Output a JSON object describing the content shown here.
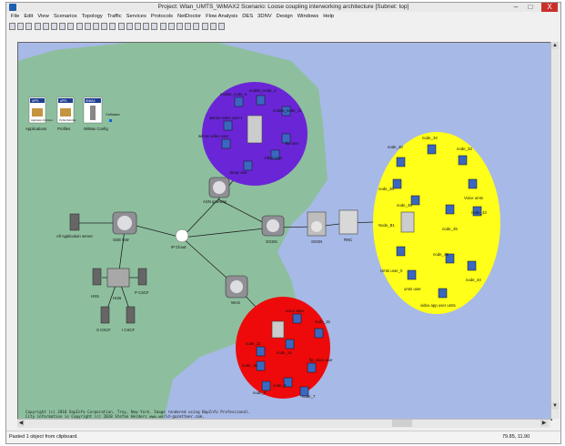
{
  "window": {
    "title": "Project: Wlan_UMTS_WiMAX2 Scenario: Loose coupling interworking architecture  [Subnet: top]",
    "minimize": "–",
    "maximize": "□",
    "close": "X"
  },
  "menu": [
    "File",
    "Edit",
    "View",
    "Scenarios",
    "Topology",
    "Traffic",
    "Services",
    "Protocols",
    "NetDoctor",
    "Flow Analysis",
    "DES",
    "3DNV",
    "Design",
    "Windows",
    "Help"
  ],
  "status": {
    "message": "Pasted 1 object from clipboard.",
    "coordinates": "79.85, 11.90"
  },
  "copyright": {
    "line1": "Copyright (c) 2018 OapInfo Corporation. Troy, New York. Image rendered using NapInfo Professional.",
    "line2": "City information is Copyright (c) 2018 Stefan Helders www.world-gazetteer.com."
  },
  "colors": {
    "canvas": "#a7b9e6",
    "land": "#8dbf9e",
    "wimax": "#6a26d6",
    "wlan": "#ffff1a",
    "red": "#ee0a0a"
  },
  "config": {
    "applications": {
      "badge": "APPL",
      "label": "Applications",
      "sub": "Application Definition"
    },
    "profiles": {
      "badge": "APPL",
      "label": "Profiles",
      "sub": "Profile Definition"
    },
    "wimax": {
      "badge": "WiMAX",
      "label": "WiMax Config"
    },
    "cellular": "Cellulare"
  },
  "nodes": {
    "app_server": "All Application server",
    "sgw": "SGE GW",
    "hss": "HSS",
    "hub": "HUB",
    "pcscf": "P CSCF",
    "scscf": "S CSCF",
    "icscf": "I CSCF",
    "ip_cloud": "IP Cloud",
    "asn_gateway": "ASN gateway",
    "ggsn": "GGSN",
    "sgsn": "SGSN",
    "rnc": "RNC",
    "wag": "WAG",
    "node_b": "Node_B1"
  },
  "wimax_cell": [
    "mobile_node_9",
    "mobile_node_3",
    "mobile_node_11",
    "wimax video user 1",
    "wimax video user",
    "ftp user",
    "Video user",
    "sleep user"
  ],
  "wlan_cell": [
    "node_34",
    "node_40",
    "node_33",
    "node_36",
    "Voice umts",
    "node_43",
    "node_38",
    "node_45",
    "Umts user_0",
    "umts user",
    "node_42",
    "node_44",
    "video app user umts"
  ],
  "red_cell": [
    "voice wlan",
    "node_15",
    "node_21",
    "node_14",
    "node_18",
    "ftp_wlan user",
    "node_9",
    "node_8",
    "node_7"
  ]
}
